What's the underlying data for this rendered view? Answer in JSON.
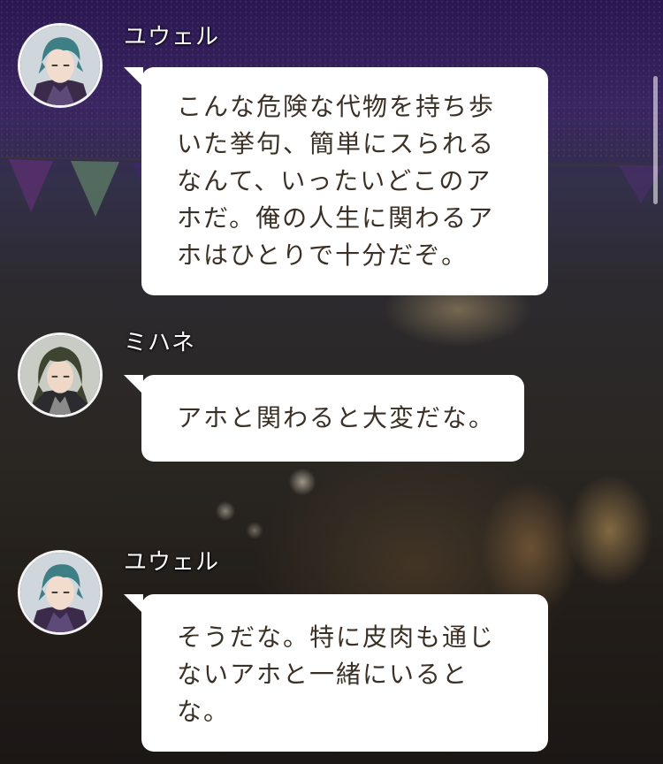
{
  "chat": {
    "messages": [
      {
        "speaker": "ユウェル",
        "avatar_icon": "character-portrait-icon",
        "lines": [
          "こんな危険な代物を持ち歩",
          "いた挙句、簡単にスられる",
          "なんて、いったいどこのア",
          "ホだ。俺の人生に関わるア",
          "ホはひとりで十分だぞ。"
        ]
      },
      {
        "speaker": "ミハネ",
        "avatar_icon": "character-portrait-icon",
        "lines": [
          "アホと関わると大変だな。"
        ]
      },
      {
        "speaker": "ユウェル",
        "avatar_icon": "character-portrait-icon",
        "lines": [
          "そうだな。特に皮肉も通じ",
          "ないアホと一緒にいると",
          "な。"
        ]
      }
    ]
  },
  "colors": {
    "bubble": "#ffffff",
    "bubble_text": "#3b3026",
    "speaker_text": "#ffffff",
    "night_sky": "#2a1850"
  }
}
